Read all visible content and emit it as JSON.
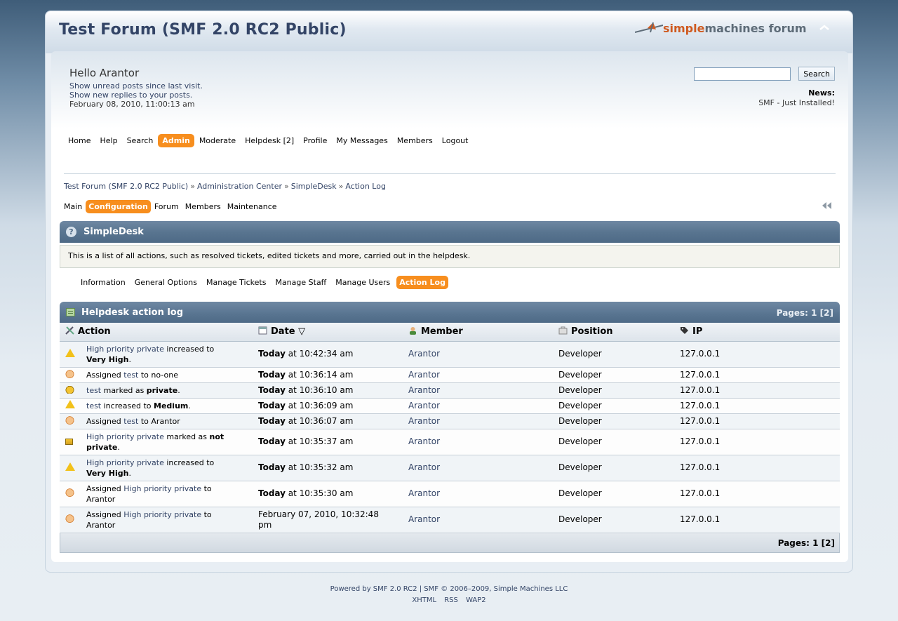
{
  "header": {
    "forum_title": "Test Forum (SMF 2.0 RC2 Public)",
    "logo_word1": "simple",
    "logo_word2": "machines forum",
    "upshrink_icon": "chevron-up-icon"
  },
  "user": {
    "hello": "Hello Arantor",
    "unread": "Show unread posts since last visit.",
    "replies": "Show new replies to your posts.",
    "date": "February 08, 2010, 11:00:13 am"
  },
  "search": {
    "value": "",
    "button": "Search",
    "news_label": "News:",
    "news_text": "SMF - Just Installed!"
  },
  "mainmenu": [
    {
      "label": "Home"
    },
    {
      "label": "Help"
    },
    {
      "label": "Search"
    },
    {
      "label": "Admin",
      "active": true
    },
    {
      "label": "Moderate"
    },
    {
      "label": "Helpdesk [2]"
    },
    {
      "label": "Profile"
    },
    {
      "label": "My Messages"
    },
    {
      "label": "Members"
    },
    {
      "label": "Logout"
    }
  ],
  "breadcrumb": [
    "Test Forum (SMF 2.0 RC2 Public)",
    "Administration Center",
    "SimpleDesk",
    "Action Log"
  ],
  "breadcrumb_sep": "»",
  "adminmenu": [
    {
      "label": "Main"
    },
    {
      "label": "Configuration",
      "active": true
    },
    {
      "label": "Forum"
    },
    {
      "label": "Members"
    },
    {
      "label": "Maintenance"
    }
  ],
  "section": {
    "title": "SimpleDesk",
    "help_glyph": "?",
    "description": "This is a list of all actions, such as resolved tickets, edited tickets and more, carried out in the helpdesk."
  },
  "submenu": [
    {
      "label": "Information"
    },
    {
      "label": "General Options"
    },
    {
      "label": "Manage Tickets"
    },
    {
      "label": "Manage Staff"
    },
    {
      "label": "Manage Users"
    },
    {
      "label": "Action Log",
      "active": true
    }
  ],
  "log": {
    "title": "Helpdesk action log",
    "pages": "Pages: 1 [2]",
    "columns": [
      "Action",
      "Date",
      "Member",
      "Position",
      "IP"
    ],
    "sort_glyph": "▽",
    "rows": [
      {
        "icon": "warn",
        "action": [
          [
            "link",
            "High priority private"
          ],
          [
            "text",
            " increased to "
          ],
          [
            "bold",
            "Very High"
          ],
          [
            "text",
            "."
          ]
        ],
        "date_bold": "Today",
        "date": " at 10:42:34 am",
        "member": "Arantor",
        "position": "Developer",
        "ip": "127.0.0.1"
      },
      {
        "icon": "hand",
        "action": [
          [
            "text",
            "Assigned "
          ],
          [
            "link",
            "test"
          ],
          [
            "text",
            " to no-one"
          ]
        ],
        "date_bold": "Today",
        "date": " at 10:36:14 am",
        "member": "Arantor",
        "position": "Developer",
        "ip": "127.0.0.1"
      },
      {
        "icon": "lock",
        "action": [
          [
            "link",
            "test"
          ],
          [
            "text",
            " marked as "
          ],
          [
            "bold",
            "private"
          ],
          [
            "text",
            "."
          ]
        ],
        "date_bold": "Today",
        "date": " at 10:36:10 am",
        "member": "Arantor",
        "position": "Developer",
        "ip": "127.0.0.1"
      },
      {
        "icon": "warn",
        "action": [
          [
            "link",
            "test"
          ],
          [
            "text",
            " increased to "
          ],
          [
            "bold",
            "Medium"
          ],
          [
            "text",
            "."
          ]
        ],
        "date_bold": "Today",
        "date": " at 10:36:09 am",
        "member": "Arantor",
        "position": "Developer",
        "ip": "127.0.0.1"
      },
      {
        "icon": "hand",
        "action": [
          [
            "text",
            "Assigned "
          ],
          [
            "link",
            "test"
          ],
          [
            "text",
            " to Arantor"
          ]
        ],
        "date_bold": "Today",
        "date": " at 10:36:07 am",
        "member": "Arantor",
        "position": "Developer",
        "ip": "127.0.0.1"
      },
      {
        "icon": "unlock",
        "action": [
          [
            "link",
            "High priority private"
          ],
          [
            "text",
            " marked as "
          ],
          [
            "bold",
            "not private"
          ],
          [
            "text",
            "."
          ]
        ],
        "date_bold": "Today",
        "date": " at 10:35:37 am",
        "member": "Arantor",
        "position": "Developer",
        "ip": "127.0.0.1"
      },
      {
        "icon": "warn",
        "action": [
          [
            "link",
            "High priority private"
          ],
          [
            "text",
            " increased to "
          ],
          [
            "bold",
            "Very High"
          ],
          [
            "text",
            "."
          ]
        ],
        "date_bold": "Today",
        "date": " at 10:35:32 am",
        "member": "Arantor",
        "position": "Developer",
        "ip": "127.0.0.1"
      },
      {
        "icon": "hand",
        "action": [
          [
            "text",
            "Assigned "
          ],
          [
            "link",
            "High priority private"
          ],
          [
            "text",
            " to Arantor"
          ]
        ],
        "date_bold": "Today",
        "date": " at 10:35:30 am",
        "member": "Arantor",
        "position": "Developer",
        "ip": "127.0.0.1"
      },
      {
        "icon": "hand",
        "action": [
          [
            "text",
            "Assigned "
          ],
          [
            "link",
            "High priority private"
          ],
          [
            "text",
            " to Arantor"
          ]
        ],
        "date_bold": "",
        "date": "February 07, 2010, 10:32:48 pm",
        "member": "Arantor",
        "position": "Developer",
        "ip": "127.0.0.1"
      }
    ]
  },
  "footer": {
    "line1": "Powered by SMF 2.0 RC2 | SMF © 2006–2009, Simple Machines LLC",
    "links": [
      "XHTML",
      "RSS",
      "WAP2"
    ]
  },
  "colors": {
    "accent": "#f78e1e",
    "link": "#334466",
    "header_bar": "#597590"
  }
}
